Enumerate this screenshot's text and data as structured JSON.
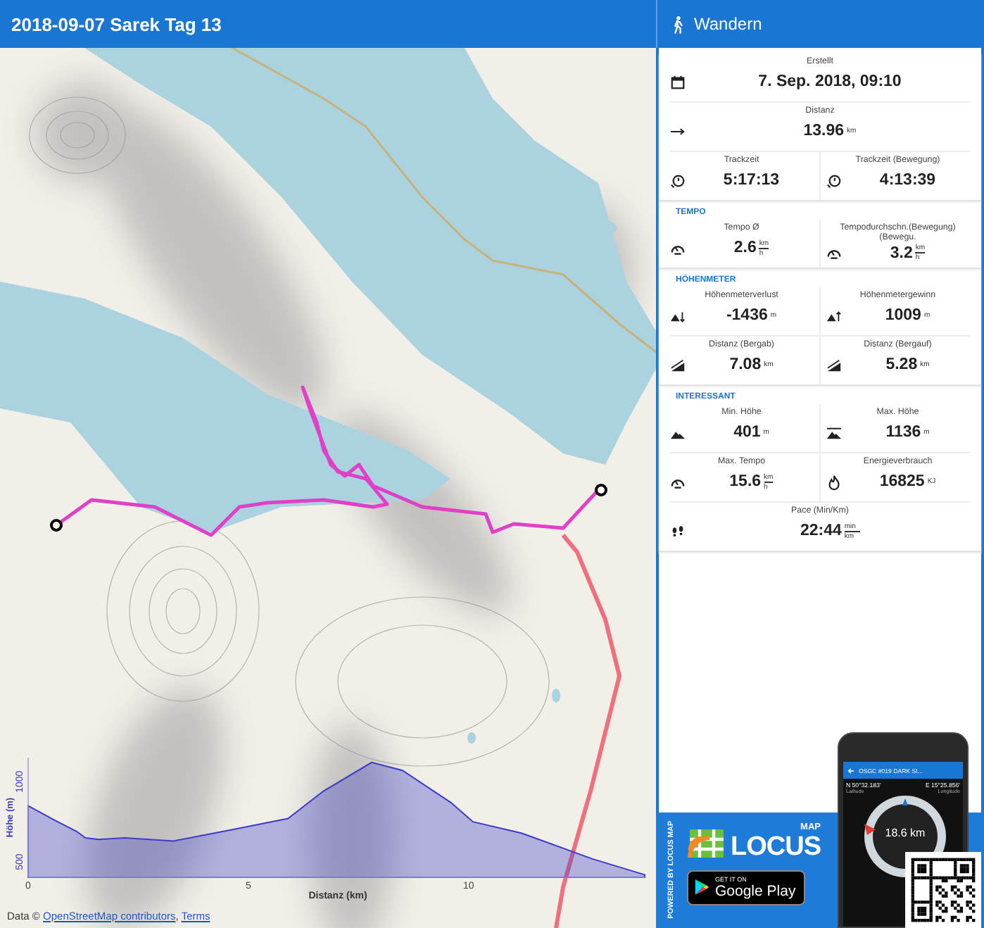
{
  "map_panel": {
    "title": "2018-09-07 Sarek Tag 13",
    "elevation_chart": {
      "chart_data": {
        "type": "area",
        "xlabel": "Distanz (km)",
        "ylabel": "Höhe (m)",
        "x": [
          0,
          0.6,
          1.1,
          1.3,
          1.6,
          2.2,
          3.3,
          4.8,
          5.9,
          6.7,
          7.8,
          8.5,
          9.6,
          10.1,
          11.2,
          12.8,
          14.0
        ],
        "series": [
          {
            "color": "#3b3bc8",
            "values": [
              850,
              760,
              690,
              650,
              640,
              650,
              630,
              710,
              770,
              940,
              1120,
              1070,
              870,
              750,
              680,
              520,
              420
            ]
          }
        ],
        "xlim": [
          0,
          14
        ],
        "ylim": [
          404,
          1150
        ],
        "xticks": [
          0,
          5,
          10
        ],
        "yticks": [
          500,
          1000
        ]
      }
    },
    "attribution": [
      {
        "kind": "text",
        "text": "Data © "
      },
      {
        "kind": "link",
        "text": "OpenStreetMap contributors"
      },
      {
        "kind": "text",
        "text": ", "
      },
      {
        "kind": "link",
        "text": "Terms"
      }
    ]
  },
  "stats_panel": {
    "title": "Wandern",
    "sections": [
      {
        "rows": [
          {
            "kind": "single",
            "stats": [
              {
                "label": "Erstellt",
                "value": "7. Sep. 2018, 09:10"
              }
            ]
          },
          {
            "kind": "single",
            "stats": [
              {
                "label": "Distanz",
                "value": "13.96",
                "unit": {
                  "kind": "plain",
                  "text": "km"
                }
              }
            ]
          },
          {
            "kind": "pair",
            "stats": [
              {
                "label": "Trackzeit",
                "value": "5:17:13"
              },
              {
                "label": "Trackzeit (Bewegung)",
                "value": "4:13:39"
              }
            ]
          }
        ]
      },
      {
        "title": "TEMPO",
        "rows": [
          {
            "kind": "pair",
            "stats": [
              {
                "label": "Tempo Ø",
                "value": "2.6",
                "unit": {
                  "kind": "fraction",
                  "top": "km",
                  "bottom": "h"
                }
              },
              {
                "label": "Tempodurchschn.(Bewegung) (Bewegu.",
                "value": "3.2",
                "unit": {
                  "kind": "fraction",
                  "top": "km",
                  "bottom": "h"
                }
              }
            ]
          }
        ]
      },
      {
        "title": "HÖHENMETER",
        "rows": [
          {
            "kind": "pair",
            "stats": [
              {
                "label": "Höhenmeterverlust",
                "value": "-1436",
                "unit": {
                  "kind": "plain",
                  "text": "m"
                }
              },
              {
                "label": "Höhenmetergewinn",
                "value": "1009",
                "unit": {
                  "kind": "plain",
                  "text": "m"
                }
              }
            ]
          },
          {
            "kind": "pair",
            "stats": [
              {
                "label": "Distanz (Bergab)",
                "value": "7.08",
                "unit": {
                  "kind": "plain",
                  "text": "km"
                }
              },
              {
                "label": "Distanz (Bergauf)",
                "value": "5.28",
                "unit": {
                  "kind": "plain",
                  "text": "km"
                }
              }
            ]
          }
        ]
      },
      {
        "title": "INTERESSANT",
        "rows": [
          {
            "kind": "pair",
            "stats": [
              {
                "label": "Min. Höhe",
                "value": "401",
                "unit": {
                  "kind": "plain",
                  "text": "m"
                }
              },
              {
                "label": "Max. Höhe",
                "value": "1136",
                "unit": {
                  "kind": "plain",
                  "text": "m"
                }
              }
            ]
          },
          {
            "kind": "pair",
            "stats": [
              {
                "label": "Max. Tempo",
                "value": "15.6",
                "unit": {
                  "kind": "fraction",
                  "top": "km",
                  "bottom": "h"
                }
              },
              {
                "label": "Energieverbrauch",
                "value": "16825",
                "unit": {
                  "kind": "plain",
                  "text": "KJ"
                }
              }
            ]
          },
          {
            "kind": "single",
            "stats": [
              {
                "label": "Pace (Min/Km)",
                "value": "22:44",
                "unit": {
                  "kind": "fraction",
                  "top": "min",
                  "bottom": "km"
                }
              }
            ]
          }
        ]
      }
    ]
  },
  "promo": {
    "vertical_text": "POWERED BY LOCUS MAP",
    "logo_text": "LOCUS",
    "logo_subtext": "MAP",
    "store_button": {
      "overline": "GET IT ON",
      "label": "Google Play"
    },
    "phone": {
      "title": "OSGC #019 DARK SI...",
      "latitude": "N 50°32.183'",
      "longitude": "E 15°25.856'",
      "latitude_label": "Latitude",
      "longitude_label": "Longitude",
      "distance": "18.6 km"
    }
  }
}
